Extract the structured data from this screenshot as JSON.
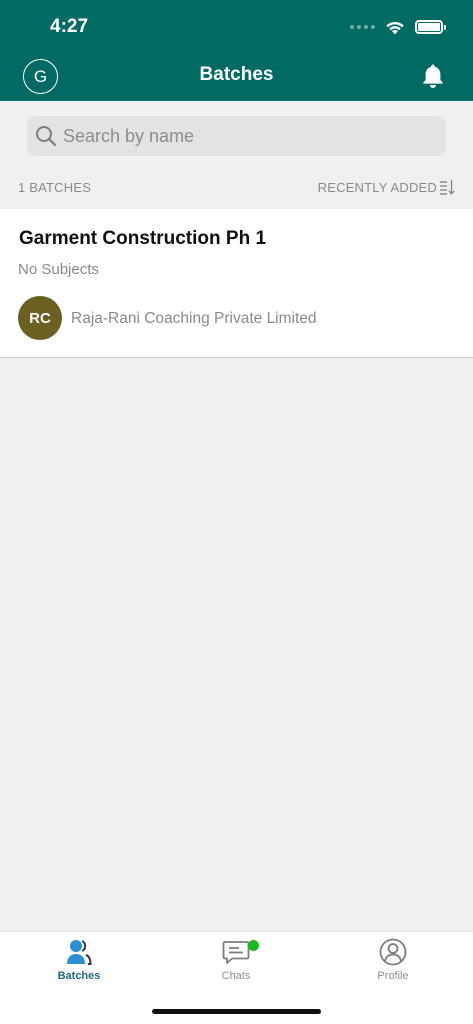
{
  "status_bar": {
    "time": "4:27"
  },
  "header": {
    "avatar_letter": "G",
    "title": "Batches"
  },
  "search": {
    "placeholder": "Search by name",
    "value": ""
  },
  "list_meta": {
    "count_label": "1 BATCHES",
    "sort_label": "RECENTLY ADDED"
  },
  "batches": [
    {
      "title": "Garment Construction Ph 1",
      "subtitle": "No Subjects",
      "org_initials": "RC",
      "org_name": "Raja-Rani Coaching Private Limited"
    }
  ],
  "tabs": [
    {
      "label": "Batches",
      "icon": "batches-icon",
      "active": true
    },
    {
      "label": "Chats",
      "icon": "chat-icon",
      "badge": true
    },
    {
      "label": "Profile",
      "icon": "profile-icon"
    }
  ],
  "colors": {
    "header_bg": "#016b63",
    "active_tab": "#1f6b77",
    "active_icon": "#2a8fd4",
    "org_avatar_bg": "#6b5f22",
    "badge": "#19b81c"
  }
}
